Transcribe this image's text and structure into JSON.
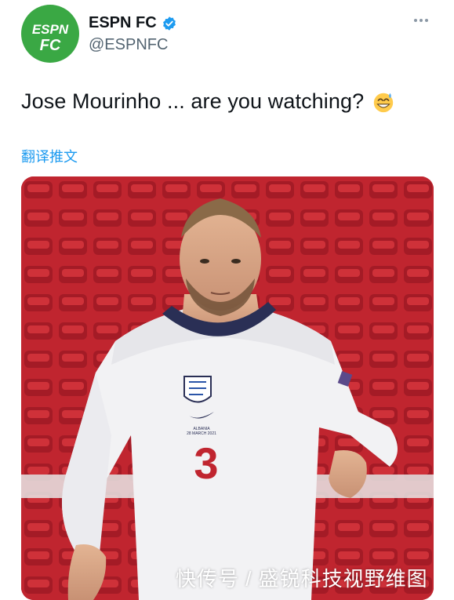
{
  "tweet": {
    "author": {
      "display_name": "ESPN FC",
      "handle": "@ESPNFC",
      "verified": true,
      "avatar_text_top": "ESPN",
      "avatar_text_bottom": "FC",
      "avatar_color": "#3aa844"
    },
    "more_icon": "more-horizontal-icon",
    "text": "Jose Mourinho ... are you watching?",
    "emoji": "grinning-sweat-emoji",
    "translate_label": "翻译推文"
  },
  "media": {
    "type": "photo",
    "shirt_number": "3",
    "shirt_text_line1": "ALBANIA",
    "shirt_text_line2": "28 MARCH 2021"
  },
  "watermark": "快传号 / 盛锐科技视野维图",
  "colors": {
    "verified": "#1d9bf0",
    "link": "#1d9bf0",
    "stand_red": "#c0252f"
  }
}
